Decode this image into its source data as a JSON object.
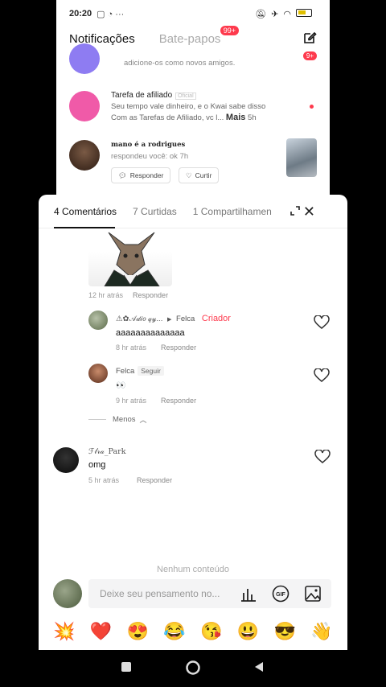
{
  "status": {
    "time": "20:20",
    "icons": [
      "chat-icon",
      "whatsapp-icon",
      "more-icon"
    ],
    "right_icons": [
      "mute-icon",
      "airplane-icon",
      "wifi-icon",
      "battery-icon"
    ]
  },
  "header": {
    "tab_notifications": "Notificações",
    "tab_chats": "Bate-papos",
    "chats_badge": "99+"
  },
  "notifications": [
    {
      "subtitle": "adicione-os como novos amigos.",
      "badge": "9+"
    },
    {
      "title": "Tarefa de afiliado",
      "tag": "Oficial",
      "line1": "Seu tempo vale dinheiro, e o Kwai sabe disso",
      "line2": "Com as Tarefas de Afiliado, vc l...",
      "more": "Mais",
      "time": "5h"
    },
    {
      "title": "mano é a rodrigues",
      "subtitle": "respondeu você: ok",
      "time": "7h",
      "reply_label": "Responder",
      "like_label": "Curtir"
    }
  ],
  "sheet": {
    "tabs": [
      "4 Comentários",
      "7 Curtidas",
      "1 Compartilhamen"
    ],
    "comments": [
      {
        "time": "12 hr atrás",
        "reply": "Responder"
      },
      {
        "name": "⚠︎✿𝒜𝒹𝒾𝑜 𝓆𝓎...",
        "arrow": "▶",
        "to": "Felca",
        "role": "Criador",
        "text": "aaaaaaaaaaaaaa",
        "time": "8 hr atrás",
        "reply": "Responder"
      },
      {
        "name": "Felca",
        "follow": "Seguir",
        "text": "👀",
        "time": "9 hr atrás",
        "reply": "Responder"
      },
      {
        "name": "ℱ𝓁𝓇𝒶_Park",
        "text": "omg",
        "time": "5 hr atrás",
        "reply": "Responder"
      }
    ],
    "less_label": "Menos",
    "empty_text": "Nenhum conteúdo",
    "input_placeholder": "Deixe seu pensamento no...",
    "emojis": [
      "💥",
      "❤️",
      "😍",
      "😂",
      "😘",
      "😃",
      "😎",
      "👋"
    ]
  },
  "colors": {
    "accent": "#fe3a4d",
    "text": "#111111",
    "muted": "#999999"
  }
}
